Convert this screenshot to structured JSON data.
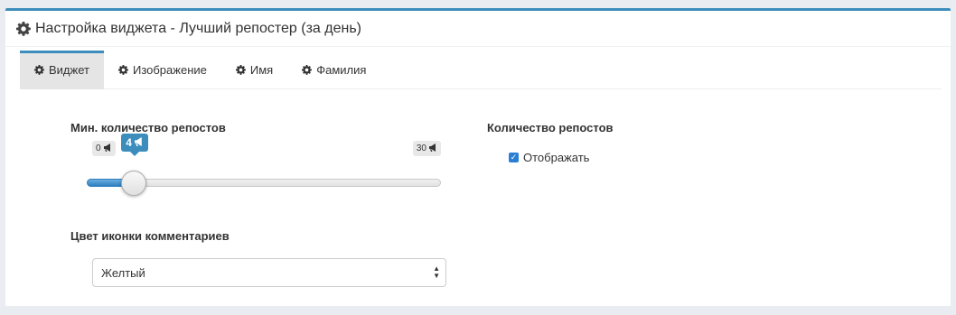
{
  "header": {
    "title": "Настройка виджета - Лучший репостер (за день)"
  },
  "tabs": [
    {
      "label": "Виджет",
      "active": true
    },
    {
      "label": "Изображение"
    },
    {
      "label": "Имя"
    },
    {
      "label": "Фамилия"
    }
  ],
  "min_reposts": {
    "label": "Мин. количество репостов",
    "min": "0",
    "max": "30",
    "value_label": "4",
    "value": 4,
    "min_value": 0,
    "max_value": 30
  },
  "repost_count": {
    "label": "Количество репостов",
    "checkbox_label": "Отображать",
    "checked": true
  },
  "comment_icon_color": {
    "label": "Цвет иконки комментариев",
    "selected": "Желтый"
  },
  "colors": {
    "accent": "#3c8dbc",
    "checkbox": "#2a7fd4"
  },
  "icons": {
    "settings": "gear-icon",
    "reposts": "megaphone-icon"
  }
}
